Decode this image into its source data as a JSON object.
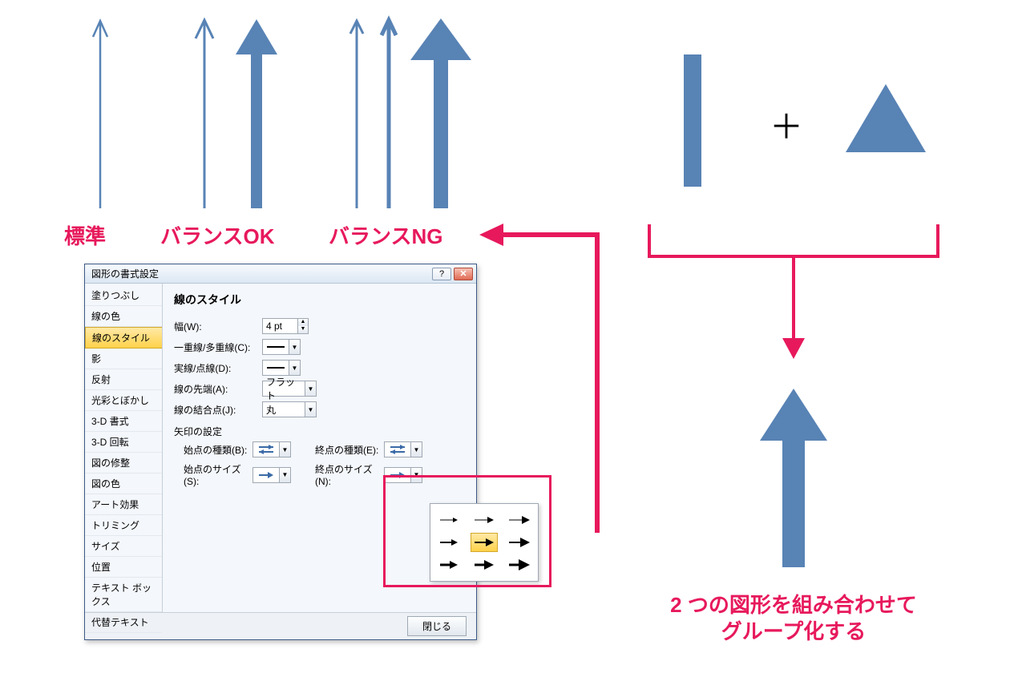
{
  "labels": {
    "standard": "標準",
    "balance_ok": "バランスOK",
    "balance_ng": "バランスNG",
    "combine_line1": "2 つの図形を組み合わせて",
    "combine_line2": "グループ化する",
    "plus": "＋"
  },
  "dialog": {
    "title": "図形の書式設定",
    "help_glyph": "?",
    "close_glyph": "✕",
    "sidebar": [
      "塗りつぶし",
      "線の色",
      "線のスタイル",
      "影",
      "反射",
      "光彩とぼかし",
      "3-D 書式",
      "3-D 回転",
      "図の修整",
      "図の色",
      "アート効果",
      "トリミング",
      "サイズ",
      "位置",
      "テキスト ボックス",
      "代替テキスト"
    ],
    "selected_sidebar_index": 2,
    "panel_title": "線のスタイル",
    "width_label": "幅(W):",
    "width_value": "4 pt",
    "compound_label": "一重線/多重線(C):",
    "dash_label": "実線/点線(D):",
    "cap_label": "線の先端(A):",
    "cap_value": "フラット",
    "join_label": "線の結合点(J):",
    "join_value": "丸",
    "arrow_section": "矢印の設定",
    "begin_type_label": "始点の種類(B):",
    "end_type_label": "終点の種類(E):",
    "begin_size_label": "始点のサイズ(S):",
    "end_size_label": "終点のサイズ(N):",
    "close_button": "閉じる"
  },
  "size_popup": {
    "rows": 3,
    "cols": 3,
    "selected_row": 1,
    "selected_col": 1
  },
  "colors": {
    "blue": "#5883b5",
    "pink": "#e7195c"
  }
}
